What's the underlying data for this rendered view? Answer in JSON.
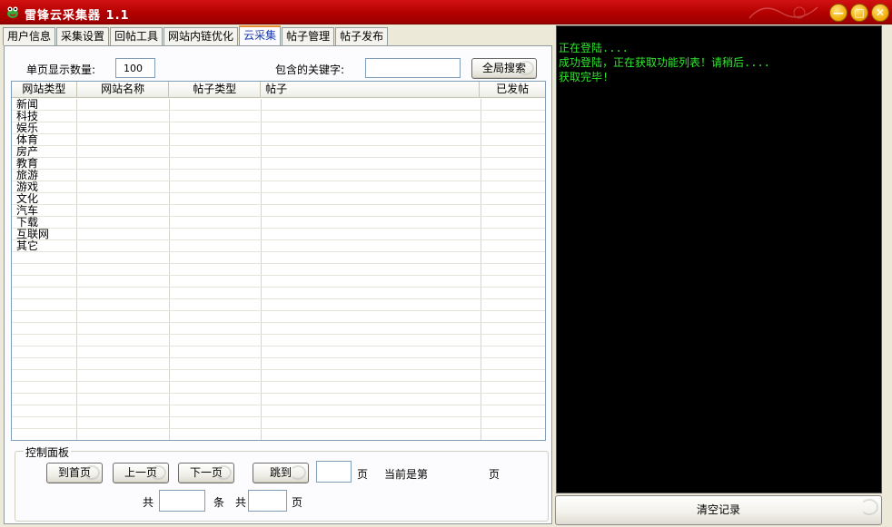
{
  "window": {
    "title": "雷锋云采集器 1.1",
    "icons": {
      "app": "frog-icon",
      "minimize": "minimize-icon",
      "maximize": "maximize-icon",
      "close": "close-icon"
    },
    "minimize_glyph": "—",
    "maximize_glyph": "□",
    "close_glyph": "✕"
  },
  "tabs": [
    {
      "label": "用户信息",
      "active": false
    },
    {
      "label": "采集设置",
      "active": false
    },
    {
      "label": "回帖工具",
      "active": false
    },
    {
      "label": "网站内链优化",
      "active": false
    },
    {
      "label": "云采集",
      "active": true
    },
    {
      "label": "帖子管理",
      "active": false
    },
    {
      "label": "帖子发布",
      "active": false
    }
  ],
  "toolbar": {
    "per_page_label": "单页显示数量:",
    "per_page_value": "100",
    "keyword_label": "包含的关键字:",
    "keyword_value": "",
    "search_button": "全局搜索"
  },
  "table": {
    "columns": [
      "网站类型",
      "网站名称",
      "帖子类型",
      "帖子",
      "已发帖"
    ],
    "categories": [
      "新闻",
      "科技",
      "娱乐",
      "体育",
      "房产",
      "教育",
      "旅游",
      "游戏",
      "文化",
      "汽车",
      "下载",
      "互联网",
      "其它"
    ]
  },
  "control_panel": {
    "title": "控制面板",
    "first_page": "到首页",
    "prev_page": "上一页",
    "next_page": "下一页",
    "jump_to": "跳到",
    "jump_value": "",
    "page_unit": "页",
    "current_page_label": "当前是第",
    "current_page_value": "",
    "current_page_unit": "页",
    "total_label": "共",
    "total_records_value": "",
    "records_unit": "条",
    "total_label2": "共",
    "total_pages_value": "",
    "pages_unit": "页"
  },
  "log": {
    "lines": [
      "正在登陆....",
      "成功登陆，正在获取功能列表！请稍后....",
      "获取完毕!"
    ],
    "text_color": "#2ee82e",
    "clear_button": "清空记录"
  },
  "colors": {
    "titlebar": "#b30000",
    "console_bg": "#000000",
    "active_tab_text": "#1a3aa8"
  }
}
